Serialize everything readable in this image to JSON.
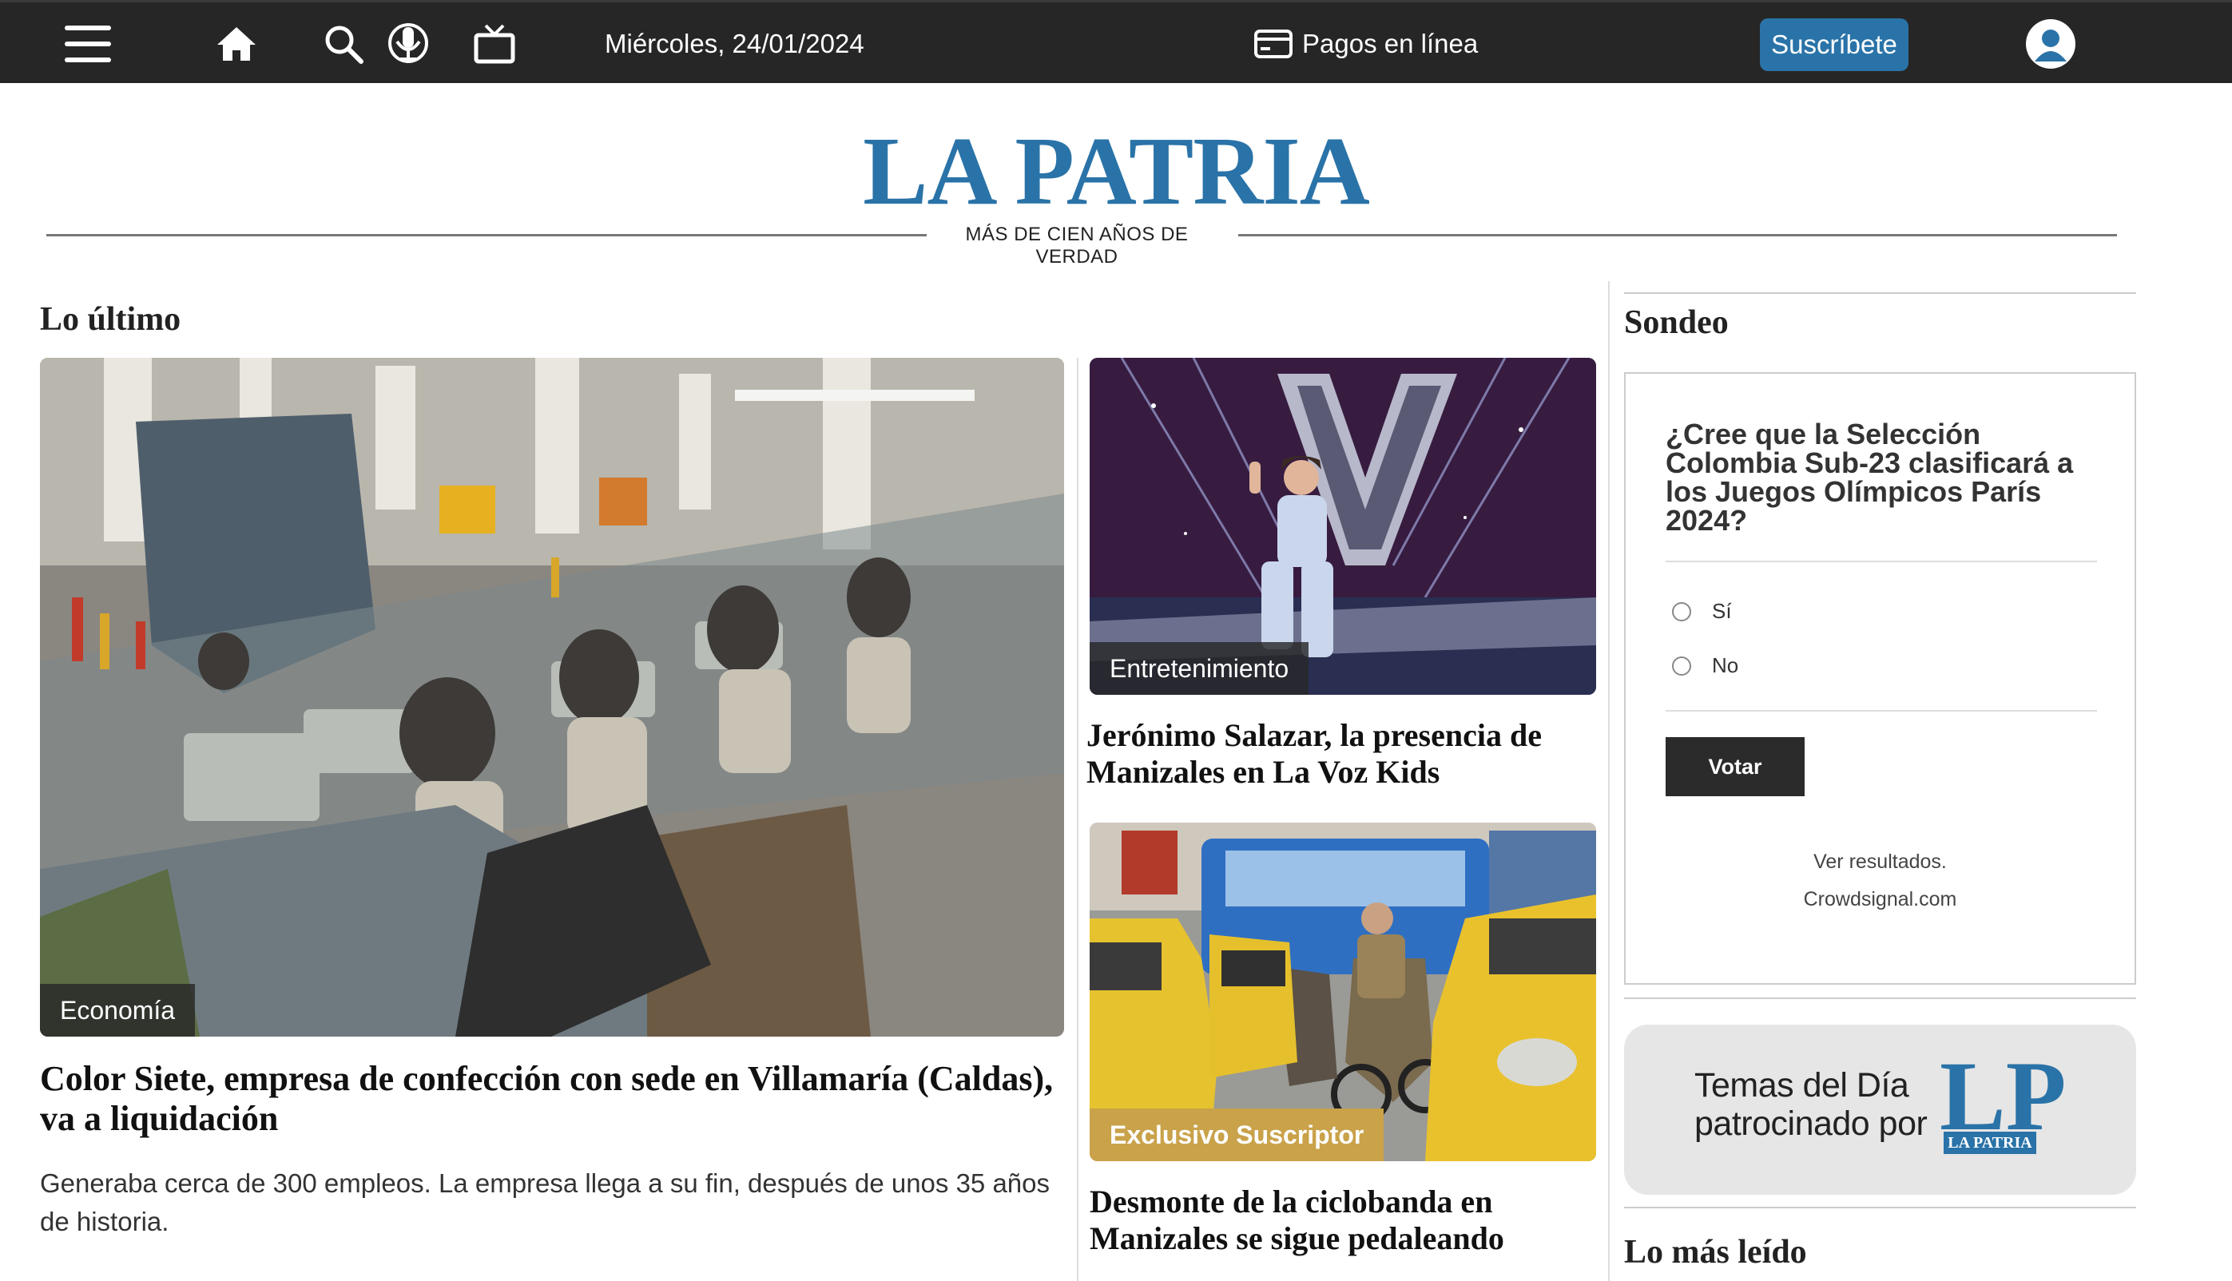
{
  "topbar": {
    "date": "Miércoles, 24/01/2024",
    "payments_label": "Pagos en línea",
    "subscribe_label": "Suscríbete",
    "icons": [
      "menu-icon",
      "home-icon",
      "search-icon",
      "podcast-icon",
      "tv-icon",
      "card-icon",
      "user-icon"
    ]
  },
  "masthead": {
    "logo": "LA PATRIA",
    "tagline": "MÁS DE CIEN AÑOS DE VERDAD"
  },
  "latest": {
    "title": "Lo último",
    "main": {
      "category": "Economía",
      "headline": "Color Siete, empresa de confección con sede en Villamaría (Caldas), va a liquidación",
      "summary": "Generaba cerca de 300 empleos. La empresa llega a su fin, después de unos 35 años de historia."
    },
    "side": [
      {
        "category": "Entretenimiento",
        "headline": "Jerónimo Salazar, la presencia de Manizales en La Voz Kids"
      },
      {
        "category": "Exclusivo Suscriptor",
        "headline": "Desmonte de la ciclobanda en Manizales se sigue pedaleando"
      }
    ]
  },
  "poll": {
    "title": "Sondeo",
    "question": "¿Cree que la Selección Colombia Sub-23 clasificará a los Juegos Olímpicos París 2024?",
    "options": [
      "Sí",
      "No"
    ],
    "vote_label": "Votar",
    "results_link": "Ver resultados.",
    "provider_link": "Crowdsignal.com"
  },
  "promo": {
    "line1": "Temas del Día",
    "line2": "patrocinado por",
    "logo": "LP",
    "logo_sub": "LA PATRIA"
  },
  "most_read": {
    "title": "Lo más leído"
  },
  "colors": {
    "brand": "#2a73a8",
    "topbar": "#262626",
    "exclusive": "#c9a24a"
  }
}
